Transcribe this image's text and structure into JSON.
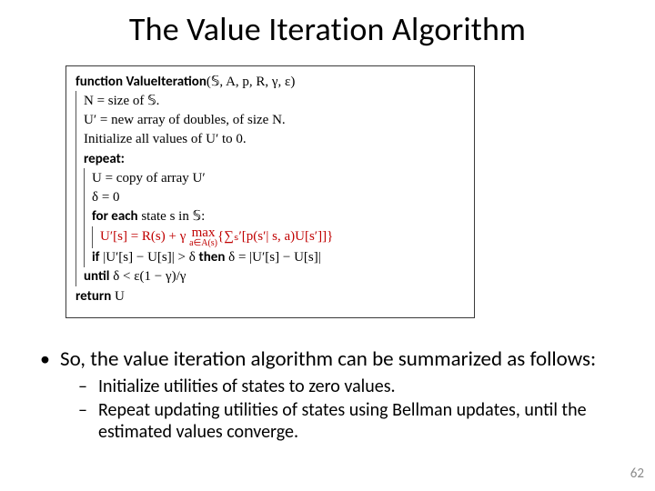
{
  "title": "The Value Iteration Algorithm",
  "algo": {
    "fn_kw": "function",
    "fn_name": "ValueIteration",
    "fn_args": "(𝕊, A, p, R, γ, ε)",
    "l_size": "N = size of 𝕊.",
    "l_uprime": "U′ = new array of doubles, of size N.",
    "l_init": "Initialize all values of U′ to 0.",
    "kw_repeat": "repeat:",
    "l_copy": "U = copy of array U′",
    "l_delta0": "δ = 0",
    "kw_foreach": "for each",
    "foreach_rest": " state  s  in 𝕊:",
    "update_lhs": "U′[s] = R(s) + γ ",
    "update_max_top": "max",
    "update_max_bot": "a∈A(s)",
    "update_rhs": "{∑ₛ′[p(s′| s, a)U[s′]]}",
    "kw_if": "if",
    "if_cond": " |U′[s] − U[s]| > δ ",
    "kw_then": "then",
    "then_body": " δ = |U′[s] − U[s]|",
    "kw_until": "until",
    "until_cond": " δ < ε(1 − γ)/γ",
    "kw_return": "return",
    "return_val": " U"
  },
  "bullets": {
    "b1": "So, the value iteration algorithm can be summarized as follows:",
    "b1a": "Initialize utilities of states to zero values.",
    "b1b": "Repeat updating utilities of states using Bellman updates, until the estimated values converge."
  },
  "pagenum": "62"
}
